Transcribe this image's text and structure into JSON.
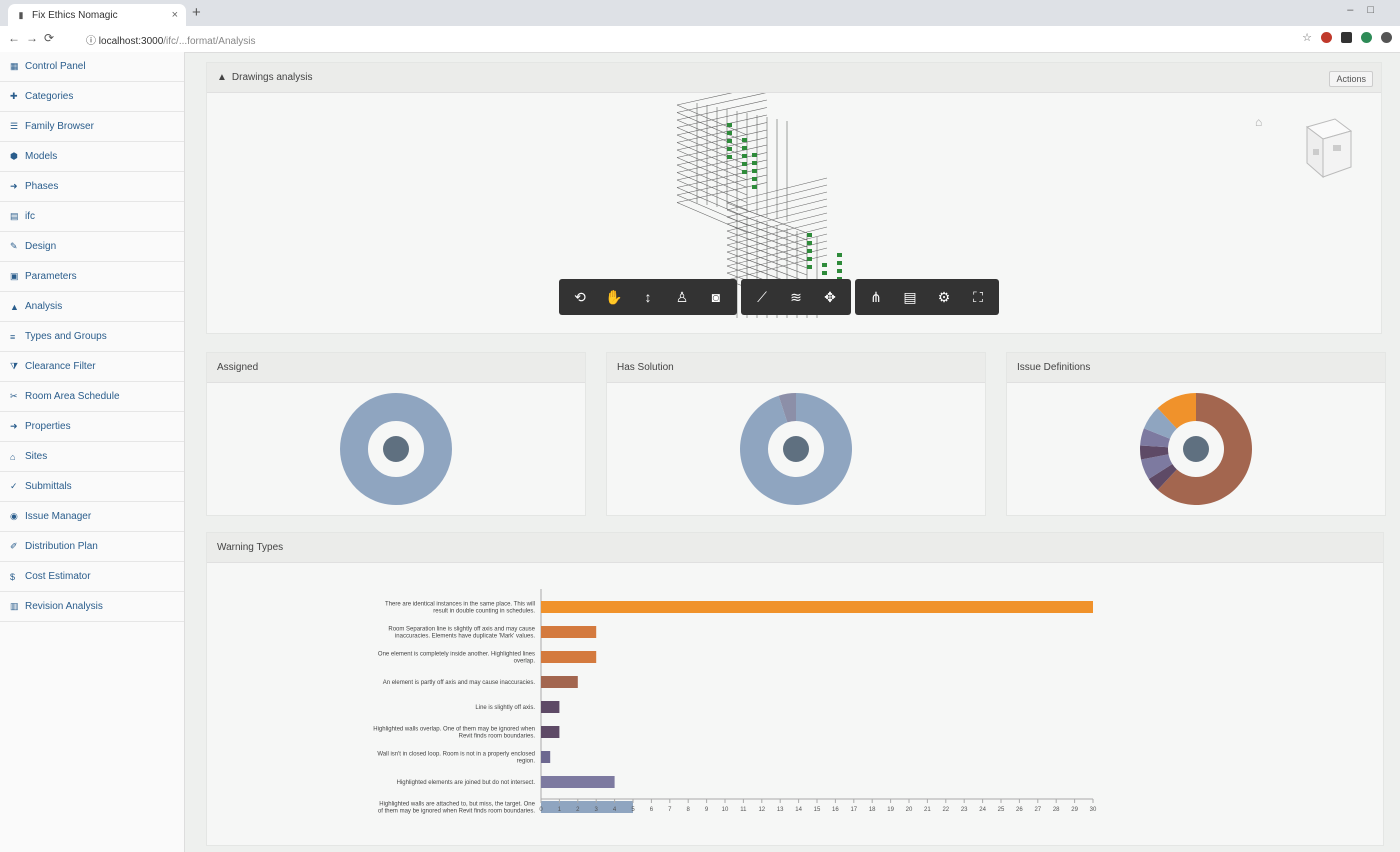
{
  "browser": {
    "tab_title": "Fix Ethics Nomagic",
    "url_host": "localhost:3000",
    "url_path": "/ifc/...format/Analysis"
  },
  "sidebar": {
    "items": [
      {
        "label": "Control Panel",
        "icon": "dashboard-icon"
      },
      {
        "label": "Categories",
        "icon": "tag-icon"
      },
      {
        "label": "Family Browser",
        "icon": "list-icon"
      },
      {
        "label": "Models",
        "icon": "cube-icon"
      },
      {
        "label": "Phases",
        "icon": "arrow-icon"
      },
      {
        "label": "ifc",
        "icon": "file-icon"
      },
      {
        "label": "Design",
        "icon": "pencil-icon"
      },
      {
        "label": "Parameters",
        "icon": "grid-icon"
      },
      {
        "label": "Analysis",
        "icon": "chart-icon"
      },
      {
        "label": "Types and Groups",
        "icon": "layers-icon"
      },
      {
        "label": "Clearance Filter",
        "icon": "filter-icon"
      },
      {
        "label": "Room Area Schedule",
        "icon": "share-icon"
      },
      {
        "label": "Properties",
        "icon": "arrow-icon"
      },
      {
        "label": "Sites",
        "icon": "home-icon"
      },
      {
        "label": "Submittals",
        "icon": "check-icon"
      },
      {
        "label": "Issue Manager",
        "icon": "globe-icon"
      },
      {
        "label": "Distribution Plan",
        "icon": "edit-icon"
      },
      {
        "label": "Cost Estimator",
        "icon": "dollar-icon"
      },
      {
        "label": "Revision Analysis",
        "icon": "clipboard-icon"
      }
    ]
  },
  "viewer_panel": {
    "title": "Drawings analysis",
    "action_label": "Actions",
    "toolbar_groups": [
      [
        "orbit-icon",
        "pan-icon",
        "zoom-icon",
        "walk-icon",
        "camera-icon"
      ],
      [
        "measure-icon",
        "section-icon",
        "explode-icon"
      ],
      [
        "model-tree-icon",
        "properties-icon",
        "settings-icon",
        "fullscreen-icon"
      ]
    ]
  },
  "donut_panels": [
    {
      "title": "Assigned",
      "segments": [
        {
          "value": 100,
          "color": "#8fa5c0"
        }
      ]
    },
    {
      "title": "Has Solution",
      "segments": [
        {
          "value": 95,
          "color": "#8fa5c0"
        },
        {
          "value": 5,
          "color": "#8c8fa8"
        }
      ]
    },
    {
      "title": "Issue Definitions",
      "segments": [
        {
          "value": 62,
          "color": "#a3664f"
        },
        {
          "value": 4,
          "color": "#5e4a66"
        },
        {
          "value": 6,
          "color": "#7d7aa0"
        },
        {
          "value": 4,
          "color": "#5e4a66"
        },
        {
          "value": 5,
          "color": "#7d7aa0"
        },
        {
          "value": 7,
          "color": "#8fa5c0"
        },
        {
          "value": 12,
          "color": "#f0922b"
        }
      ]
    }
  ],
  "bar_panel": {
    "title": "Warning Types"
  },
  "chart_data": {
    "type": "bar",
    "orientation": "horizontal",
    "categories": [
      "There are identical instances in the same place. This will result in double counting in schedules.",
      "Room Separation line is slightly off axis and may cause inaccuracies. Elements have duplicate 'Mark' values.",
      "One element is completely inside another. Highlighted lines overlap.",
      "An element is partly off axis and may cause inaccuracies.",
      "Line is slightly off axis.",
      "Highlighted walls overlap. One of them may be ignored when Revit finds room boundaries.",
      "Wall isn't in closed loop. Room is not in a properly enclosed region.",
      "Highlighted elements are joined but do not intersect.",
      "Highlighted walls are attached to, but miss, the target. One of them may be ignored when Revit finds room boundaries."
    ],
    "values": [
      30,
      3,
      3,
      2,
      1,
      1,
      0.5,
      4,
      5
    ],
    "colors": [
      "#f0922b",
      "#d47a3e",
      "#d47a3e",
      "#a3664f",
      "#5e4a66",
      "#5e4a66",
      "#6d6890",
      "#7d7aa0",
      "#8fa5c0"
    ],
    "xticks": [
      0,
      1,
      2,
      3,
      4,
      5,
      6,
      7,
      8,
      9,
      10,
      11,
      12,
      13,
      14,
      15,
      16,
      17,
      18,
      19,
      20,
      21,
      22,
      23,
      24,
      25,
      26,
      27,
      28,
      29,
      30
    ],
    "xlim": [
      0,
      30
    ]
  }
}
